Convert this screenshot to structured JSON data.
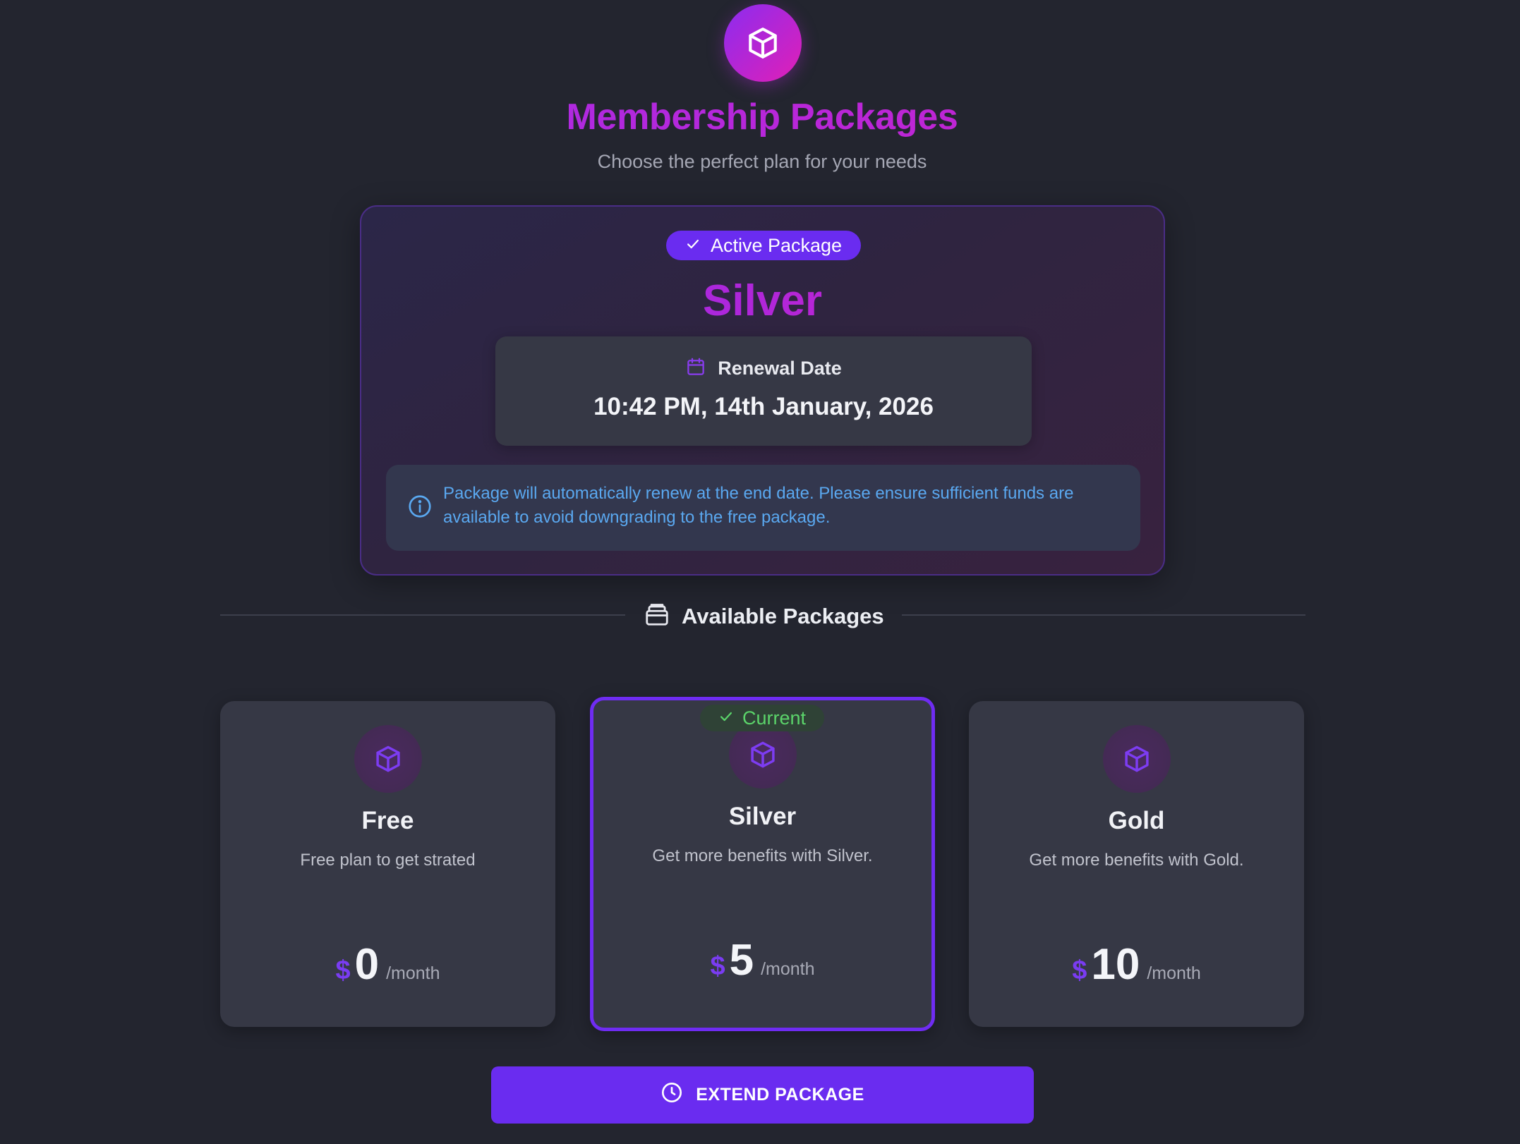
{
  "header": {
    "icon": "cube-icon",
    "title": "Membership Packages",
    "subtitle": "Choose the perfect plan for your needs"
  },
  "active_package": {
    "badge_label": "Active Package",
    "badge_icon": "check-icon",
    "name": "Silver",
    "renewal": {
      "icon": "calendar-icon",
      "label": "Renewal Date",
      "date": "10:42 PM, 14th January, 2026"
    },
    "notice": {
      "icon": "info-icon",
      "text": "Package will automatically renew at the end date. Please ensure sufficient funds are available to avoid downgrading to the free package."
    }
  },
  "available": {
    "icon": "package-icon",
    "title": "Available Packages"
  },
  "plans": [
    {
      "name": "Free",
      "description": "Free plan to get strated",
      "currency": "$",
      "price": "0",
      "period": "/month",
      "icon": "cube-icon",
      "current": false
    },
    {
      "name": "Silver",
      "description": "Get more benefits with Silver.",
      "currency": "$",
      "price": "5",
      "period": "/month",
      "icon": "cube-icon",
      "current": true
    },
    {
      "name": "Gold",
      "description": "Get more benefits with Gold.",
      "currency": "$",
      "price": "10",
      "period": "/month",
      "icon": "cube-icon",
      "current": false
    }
  ],
  "current_badge": {
    "label": "Current",
    "icon": "check-icon"
  },
  "extend_button": {
    "label": "EXTEND PACKAGE",
    "icon": "clock-icon"
  },
  "colors": {
    "background": "#23252f",
    "accent": "#6a2cf0",
    "gradient_start": "#8b2cf0",
    "gradient_end": "#e11fb6",
    "info_text": "#5aa8f0",
    "success": "#5bd46a"
  }
}
